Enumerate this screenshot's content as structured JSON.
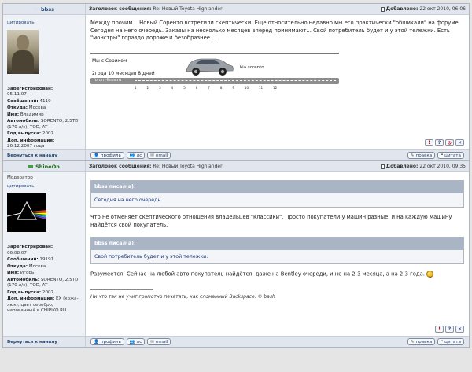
{
  "posts": [
    {
      "author": "bbss",
      "status_color": "#d9e2f0",
      "subject_label": "Заголовок сообщения:",
      "subject": "Re: Новый Toyota Highlander",
      "date_label": "Добавлено:",
      "date": "22 окт 2010, 06:06",
      "cite_label": "цитировать",
      "info": [
        {
          "label": "Зарегистрирован:",
          "value": "05.11.07"
        },
        {
          "label": "Сообщений:",
          "value": "4119"
        },
        {
          "label": "Откуда:",
          "value": "Москва"
        },
        {
          "label": "Имя:",
          "value": "Владимир"
        },
        {
          "label": "Автомобиль:",
          "value": "SORENTO, 2.5TD (170 л/с), TOD, AT"
        },
        {
          "label": "Год выпуска:",
          "value": "2007"
        },
        {
          "label": "Доп. информация:",
          "value": "26.12.2007 года"
        }
      ],
      "text": "Между прочим... Новый Соренто встретили скептически. Еще относительно недавно мы его практически \"обшикали\" на форуме. Сегодня на него очередь. Заказы на несколько месяцев вперед принимают... Свой потребитель будет и у этой тележки. Есть \"монстры\" гораздо дороже и безобразнее...",
      "signature": {
        "line1": "Мы с Сориком",
        "line2": "2года 10 месяцев 8 дней",
        "model": "kia sorento",
        "site": "forum-lines.ru",
        "ticks": [
          "1",
          "2",
          "3",
          "4",
          "5",
          "6",
          "7",
          "8",
          "9",
          "10",
          "11",
          "12"
        ]
      }
    },
    {
      "author": "ShineOn",
      "status_color": "#3ba535",
      "subject_label": "Заголовок сообщения:",
      "subject": "Re: Новый Toyota Highlander",
      "date_label": "Добавлено:",
      "date": "22 окт 2010, 09:35",
      "rank": "Модератор",
      "cite_label": "цитировать",
      "info": [
        {
          "label": "Зарегистрирован:",
          "value": "06.08.07"
        },
        {
          "label": "Сообщений:",
          "value": "19191"
        },
        {
          "label": "Откуда:",
          "value": "Москва"
        },
        {
          "label": "Имя:",
          "value": "Игорь"
        },
        {
          "label": "Автомобиль:",
          "value": "SORENTO, 2.5TD (170 л/с), TOD, AT"
        },
        {
          "label": "Год выпуска:",
          "value": "2007"
        },
        {
          "label": "Доп. информация:",
          "value": "EX (кожа-люк), цвет серебро, чипованный в CHIPIKO.RU"
        }
      ],
      "quote1_head": "bbss писал(а):",
      "quote1_text": "Сегодня на него очередь.",
      "para1": "Что не отменяет скептического отношения владельцев \"классики\". Просто покупатели у машин разные, и на каждую машину найдётся свой покупатель.",
      "quote2_head": "bbss писал(а):",
      "quote2_text": "Свой потребитель будет и у этой тележки.",
      "para2": "Разумеется! Сейчас на любой авто покупатель найдётся, даже на Bentley очереди, и не на 2-3 месяца, а на 2-3 года.",
      "signature_text": "Ни что так не учит грамотно печатать, как сломанный Backspace. © bash"
    }
  ],
  "footer": {
    "back_to_top": "Вернуться к началу",
    "profile": "профиль",
    "pm": "лс",
    "email": "email",
    "edit": "правка",
    "quote": "цитата"
  },
  "icons": {
    "report": "!",
    "info": "?",
    "warn": "⦸",
    "delete": "✕"
  }
}
